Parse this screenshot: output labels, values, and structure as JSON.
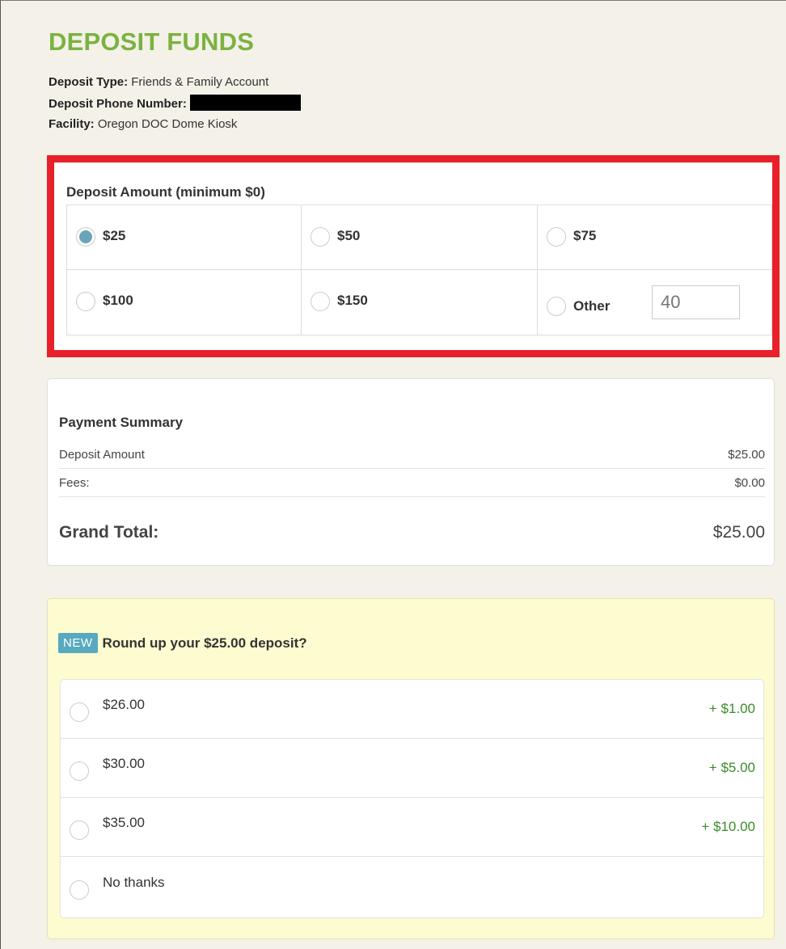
{
  "header": {
    "title": "DEPOSIT FUNDS",
    "deposit_type_label": "Deposit Type:",
    "deposit_type_value": "Friends & Family Account",
    "phone_label": "Deposit Phone Number:",
    "facility_label": "Facility:",
    "facility_value": "Oregon DOC Dome Kiosk"
  },
  "deposit_amount": {
    "heading": "Deposit Amount (minimum $0)",
    "options": [
      {
        "label": "$25",
        "selected": true
      },
      {
        "label": "$50",
        "selected": false
      },
      {
        "label": "$75",
        "selected": false
      },
      {
        "label": "$100",
        "selected": false
      },
      {
        "label": "$150",
        "selected": false
      },
      {
        "label": "Other",
        "selected": false
      }
    ],
    "other_placeholder": "40"
  },
  "payment_summary": {
    "heading": "Payment Summary",
    "rows": [
      {
        "label": "Deposit Amount",
        "value": "$25.00"
      },
      {
        "label": "Fees:",
        "value": "$0.00"
      }
    ],
    "grand_total_label": "Grand Total:",
    "grand_total_value": "$25.00"
  },
  "round_up": {
    "badge": "NEW",
    "heading": "Round up your $25.00 deposit?",
    "options": [
      {
        "label": "$26.00",
        "extra": "+ $1.00"
      },
      {
        "label": "$30.00",
        "extra": "+ $5.00"
      },
      {
        "label": "$35.00",
        "extra": "+ $10.00"
      },
      {
        "label": "No thanks",
        "extra": ""
      }
    ]
  },
  "colors": {
    "title_green": "#7bb241",
    "highlight_red": "#e8202a",
    "radio_selected": "#6aa4b8",
    "badge_blue": "#58a9bf",
    "plus_green": "#3b8c2a",
    "roundup_bg": "#fdfbd0"
  }
}
